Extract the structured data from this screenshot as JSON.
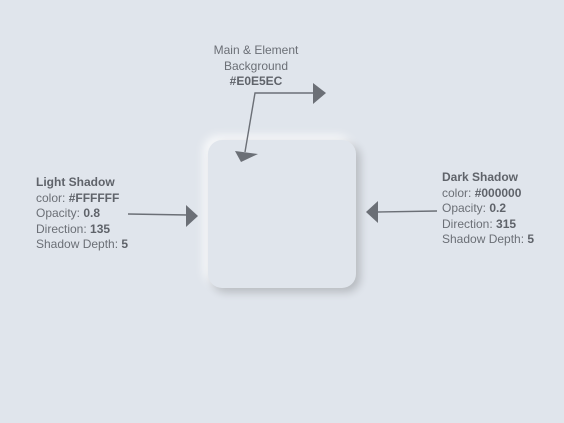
{
  "background_label": {
    "line1": "Main & Element",
    "line2": "Background",
    "value": "#E0E5EC"
  },
  "light_shadow": {
    "title": "Light Shadow",
    "color_label": "color: ",
    "color_value": "#FFFFFF",
    "opacity_label": "Opacity: ",
    "opacity_value": "0.8",
    "direction_label": "Direction: ",
    "direction_value": "135",
    "depth_label": "Shadow Depth: ",
    "depth_value": "5"
  },
  "dark_shadow": {
    "title": "Dark Shadow",
    "color_label": "color: ",
    "color_value": "#000000",
    "opacity_label": "Opacity: ",
    "opacity_value": "0.2",
    "direction_label": "Direction: ",
    "direction_value": "315",
    "depth_label": "Shadow Depth: ",
    "depth_value": "5"
  },
  "colors": {
    "background": "#E0E5EC",
    "arrow": "#6b6f76",
    "text": "#6b6f76"
  }
}
